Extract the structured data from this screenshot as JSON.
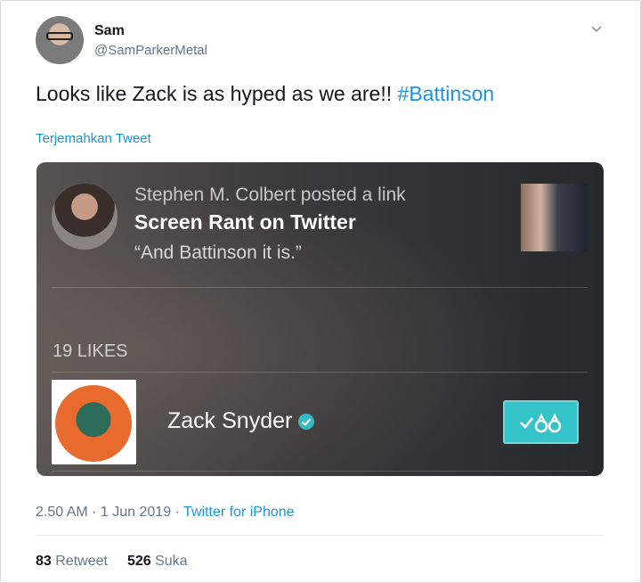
{
  "tweet": {
    "author_name": "Sam",
    "author_handle": "@SamParkerMetal",
    "text": "Looks like Zack is as hyped as we are!! ",
    "hashtag": "#Battinson",
    "translate_label": "Terjemahkan Tweet",
    "timestamp": "2.50 AM · 1 Jun 2019",
    "separator": " · ",
    "source": "Twitter for iPhone",
    "retweets_count": "83",
    "retweets_label": "Retweet",
    "likes_count": "526",
    "likes_label": "Suka"
  },
  "card": {
    "posted_line": "Stephen M. Colbert posted a link",
    "link_title": "Screen Rant on Twitter",
    "quote": "“And Battinson it is.”",
    "likes_header": "19 LIKES",
    "liker_name": "Zack Snyder",
    "follow_icon": "check-binoculars-icon"
  },
  "colors": {
    "link": "#1b95e0",
    "secondary_text": "#657786",
    "follow_button": "#34c3c9",
    "verified_badge": "#35b9c6"
  }
}
